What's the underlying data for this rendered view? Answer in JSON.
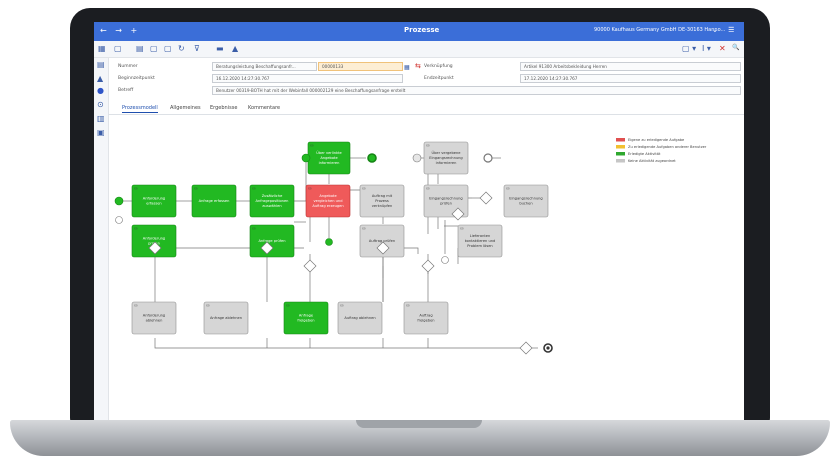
{
  "window": {
    "title": "Prozesse",
    "company": "90000 Kaufhaus Germany GmbH DE-30163 Hanno...",
    "nav_glyphs": "← → +",
    "controls": "⌄ ☰"
  },
  "toolbar": {
    "icons": [
      "grid-icon",
      "new-doc-icon",
      "save-icon",
      "copy-icon",
      "doc-icon",
      "refresh-icon",
      "filter-icon",
      "dash-icon",
      "printer-icon"
    ],
    "glyphs": [
      "▦",
      "▢",
      "▤",
      "▢",
      "▢",
      "↻",
      "⊽",
      "▬",
      "▲"
    ],
    "right_glyphs": [
      "▢ ▾",
      "I ▾",
      "✕",
      "🔍"
    ]
  },
  "sidebar": {
    "glyphs": [
      "▤",
      "▲",
      "●",
      "⊙",
      "▥",
      "▣"
    ]
  },
  "form": {
    "nummer_label": "Nummer",
    "nummer_value": "Beratungsleistung Beschaffungsanfr...",
    "nummer_highlight": "00000133",
    "beginn_label": "Beginnzeitpunkt",
    "beginn_value": "16.12.2020 14:27:30.767",
    "betreff_label": "Betreff",
    "betreff_value": "Benutzer 00319-BOTH hat mit der Webinfall 000002129 eine Beschaffungsanfrage erstellt",
    "verknuepfung_label": "Verknüpfung",
    "verknuepfung_value": "Artikel 91300 Arbeitsbekleidung Herren",
    "ende_label": "Endzeitpunkt",
    "ende_value": "17.12.2020 14:27:30.767"
  },
  "tabs": [
    "Prozessmodell",
    "Allgemeines",
    "Ergebnisse",
    "Kommentare"
  ],
  "legend": [
    {
      "label": "Eigene zu erledigende Aufgabe",
      "color": "#e05050"
    },
    {
      "label": "Zu erledigende Aufgaben anderer Benutzer",
      "color": "#f2c030"
    },
    {
      "label": "Erledigte Aktivität",
      "color": "#2fa82f"
    },
    {
      "label": "Keine Aktivität zugeordnet",
      "color": "#c6c6c6"
    }
  ],
  "tasks": [
    {
      "id": "t1",
      "label": "Anforderung erfassen",
      "status": "done"
    },
    {
      "id": "t2",
      "label": "Anfrage erfassen",
      "status": "done"
    },
    {
      "id": "t3",
      "label": "Zusätzliche Anfragepositionen auswählen",
      "status": "done"
    },
    {
      "id": "t4",
      "label": "Über verlinkte Angebote informieren",
      "status": "done"
    },
    {
      "id": "t5",
      "label": "Anforderung prüfen",
      "status": "done"
    },
    {
      "id": "t6",
      "label": "Anfrage prüfen",
      "status": "done"
    },
    {
      "id": "t7",
      "label": "Angebote vergleichen und Auftrag erzeugen",
      "status": "own"
    },
    {
      "id": "t8",
      "label": "Auftrag mit Prozess verknüpfen",
      "status": "none"
    },
    {
      "id": "t9",
      "label": "Auftrag prüfen",
      "status": "none"
    },
    {
      "id": "t10",
      "label": "Über vergebene Eingangsrechnung informieren",
      "status": "none"
    },
    {
      "id": "t11",
      "label": "Eingangsrechnung prüfen",
      "status": "none"
    },
    {
      "id": "t12",
      "label": "Eingangsrechnung buchen",
      "status": "none"
    },
    {
      "id": "t13",
      "label": "Lieferanten kontaktieren und Problem lösen",
      "status": "none"
    },
    {
      "id": "t14",
      "label": "Anforderung ablehnen",
      "status": "none"
    },
    {
      "id": "t15",
      "label": "Anfrage ablehnen",
      "status": "none"
    },
    {
      "id": "t16",
      "label": "Anfrage freigeben",
      "status": "done"
    },
    {
      "id": "t17",
      "label": "Auftrag ablehnen",
      "status": "none"
    },
    {
      "id": "t18",
      "label": "Auftrag freigeben",
      "status": "none"
    }
  ],
  "colors": {
    "done_fill": "#22b922",
    "done_stroke": "#158515",
    "own_fill": "#ef5a5a",
    "own_stroke": "#b83030",
    "none_fill": "#d6d6d6",
    "none_stroke": "#8f8f8f",
    "accent": "#3b6ed8"
  }
}
